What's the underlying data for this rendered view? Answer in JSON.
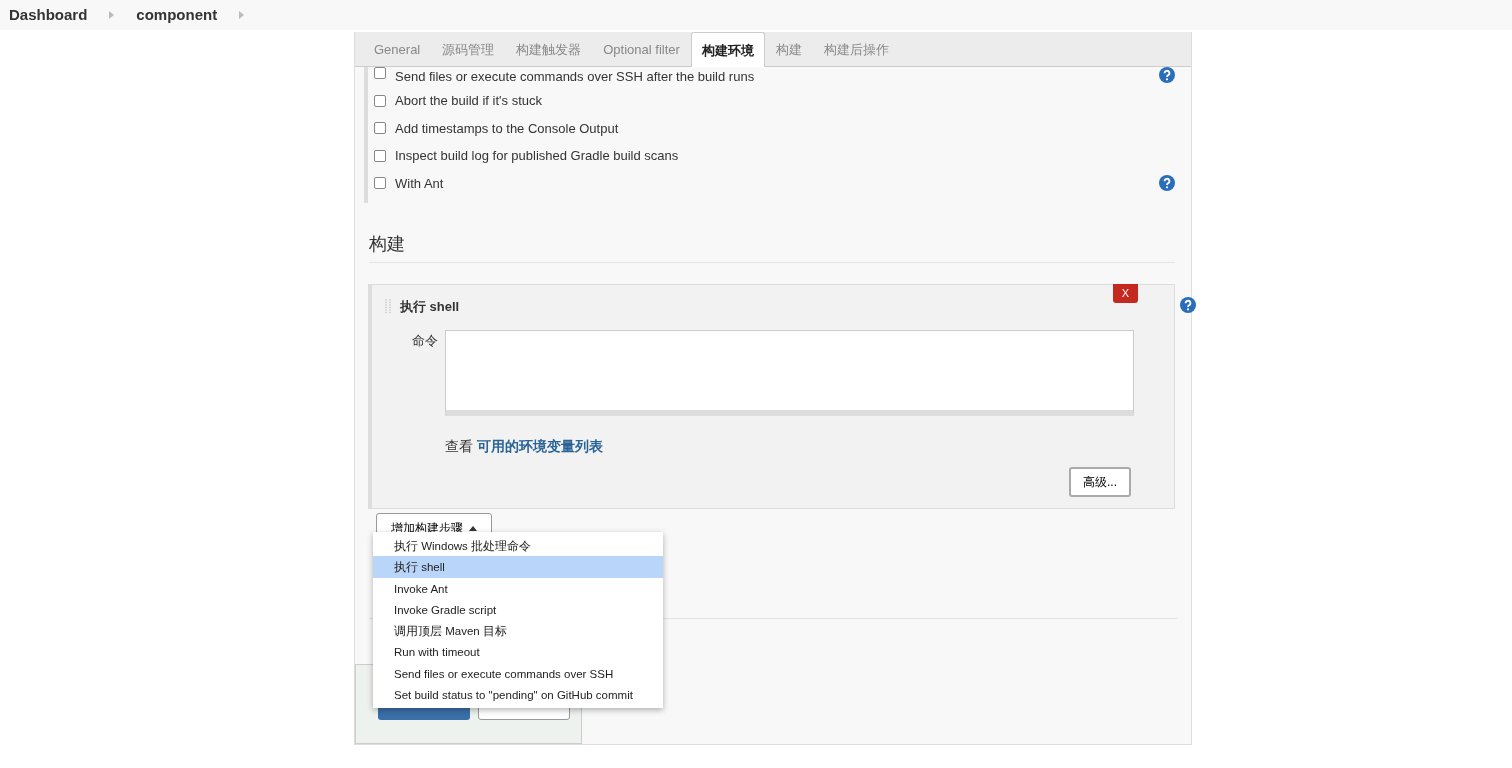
{
  "breadcrumbs": [
    "Dashboard",
    "component"
  ],
  "tabs": [
    {
      "label": "General",
      "selected": false
    },
    {
      "label": "源码管理",
      "selected": false
    },
    {
      "label": "构建触发器",
      "selected": false
    },
    {
      "label": "Optional filter",
      "selected": false
    },
    {
      "label": "构建环境",
      "selected": true
    },
    {
      "label": "构建",
      "selected": false
    },
    {
      "label": "构建后操作",
      "selected": false
    }
  ],
  "options": [
    {
      "label": "Send files or execute commands over SSH after the build runs",
      "checked": false,
      "help": true
    },
    {
      "label": "Abort the build if it's stuck",
      "checked": false,
      "help": false
    },
    {
      "label": "Add timestamps to the Console Output",
      "checked": false,
      "help": false
    },
    {
      "label": "Inspect build log for published Gradle build scans",
      "checked": false,
      "help": false
    },
    {
      "label": "With Ant",
      "checked": false,
      "help": true
    }
  ],
  "section_title": "构建",
  "build_step": {
    "delete": "X",
    "title": "执行 shell",
    "field_label": "命令",
    "hint_prefix": "查看",
    "hint_link": "可用的环境变量列表",
    "advanced_button": "高级..."
  },
  "add_step_button": "增加构建步骤",
  "menu": [
    {
      "label": "执行 Windows 批处理命令",
      "selected": false
    },
    {
      "label": "执行 shell",
      "selected": true
    },
    {
      "label": "Invoke Ant",
      "selected": false
    },
    {
      "label": "Invoke Gradle script",
      "selected": false
    },
    {
      "label": "调用顶层 Maven 目标",
      "selected": false
    },
    {
      "label": "Run with timeout",
      "selected": false
    },
    {
      "label": "Send files or execute commands over SSH",
      "selected": false
    },
    {
      "label": "Set build status to \"pending\" on GitHub commit",
      "selected": false
    }
  ]
}
